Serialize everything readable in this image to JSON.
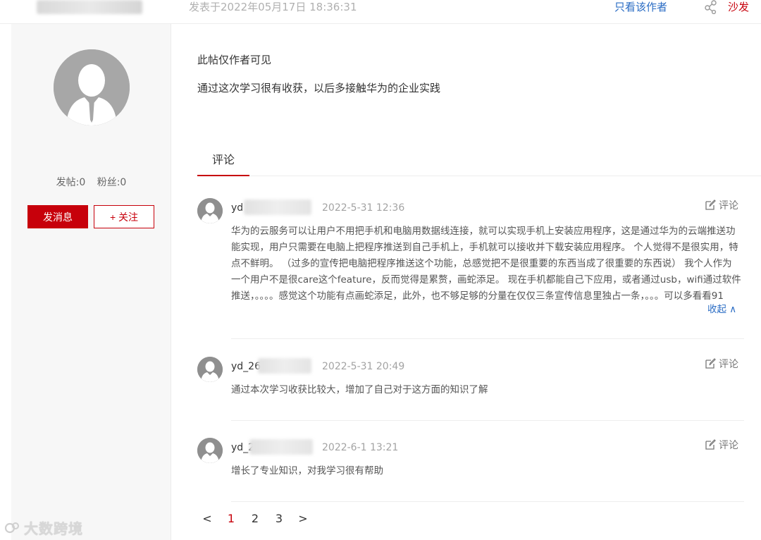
{
  "header": {
    "post_time": "发表于2022年05月17日 18:36:31",
    "only_author": "只看该作者",
    "floor_label": "沙发"
  },
  "sidebar": {
    "posts_stat": "发帖:0",
    "fans_stat": "粉丝:0",
    "message_button": "发消息",
    "follow_button": "+ 关注"
  },
  "post": {
    "visibility_note": "此帖仅作者可见",
    "body": "通过这次学习很有收获，以后多接触华为的企业实践"
  },
  "tabs": {
    "comment_tab": "评论"
  },
  "comments": [
    {
      "name": "yd",
      "time": "2022-5-31 12:36",
      "reply_label": "评论",
      "text": "华为的云服务可以让用户不用把手机和电脑用数据线连接，就可以实现手机上安装应用程序，这是通过华为的云端推送功能实现，用户只需要在电脑上把程序推送到自己手机上，手机就可以接收并下载安装应用程序。 个人觉得不是很实用，特点不鲜明。 （过多的宣传把电脑把程序推送这个功能，总感觉把不是很重要的东西当成了很重要的东西说） 我个人作为一个用户不是很care这个feature，反而觉得是累赘，画蛇添足。 现在手机都能自己下应用，或者通过usb，wifi通过软件推送，。。。。感觉这个功能有点画蛇添足，此外，也不够足够的分量在仅仅三条宣传信息里独占一条，。。。可以多看看91",
      "collapse_label": "收起 ∧"
    },
    {
      "name": "yd_26",
      "time": "2022-5-31 20:49",
      "reply_label": "评论",
      "text": "通过本次学习收获比较大，增加了自己对于这方面的知识了解"
    },
    {
      "name": "yd_2",
      "time": "2022-6-1 13:21",
      "reply_label": "评论",
      "text": "增长了专业知识，对我学习很有帮助"
    }
  ],
  "pagination": {
    "prev": "<",
    "pages": [
      "1",
      "2",
      "3"
    ],
    "next": ">",
    "current": "1"
  },
  "watermark": "大数跨境",
  "colors": {
    "brand_red": "#c7000b",
    "link_blue": "#2a6cc4"
  }
}
